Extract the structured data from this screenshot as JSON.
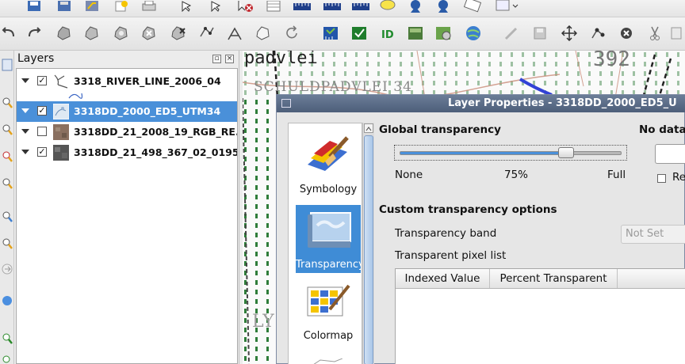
{
  "layers_panel": {
    "title": "Layers",
    "layers": [
      {
        "name": "3318_RIVER_LINE_2006_04",
        "checked": true,
        "selected": false
      },
      {
        "name": "3318DD_2000_ED5_UTM34",
        "checked": true,
        "selected": true
      },
      {
        "name": "3318DD_21_2008_19_RGB_RE...",
        "checked": false,
        "selected": false
      },
      {
        "name": "3318DD_21_498_367_02_0195_...",
        "checked": true,
        "selected": false
      }
    ]
  },
  "map": {
    "labels": {
      "padvlei": "padvlei",
      "schuldpadvlei": "SCHULDPADVLEI 34",
      "number": "392",
      "ly": "LY"
    }
  },
  "dialog": {
    "title": "Layer Properties - 3318DD_2000_ED5_U",
    "tabs": {
      "symbology": "Symbology",
      "transparency": "Transparency",
      "colormap": "Colormap"
    },
    "global_transparency": {
      "heading": "Global transparency",
      "min_label": "None",
      "value_label": "75%",
      "max_label": "Full",
      "value": 0.75
    },
    "nodata": {
      "heading": "No data",
      "checkbox_label": "Re"
    },
    "custom": {
      "heading": "Custom transparency options",
      "band_label": "Transparency band",
      "band_value": "Not Set",
      "pixel_list_label": "Transparent pixel list",
      "columns": [
        "Indexed Value",
        "Percent Transparent"
      ]
    }
  },
  "colors": {
    "selection": "#4a90d9",
    "dialog_title": "#5a6b86",
    "map_green": "#2f7d3a"
  }
}
